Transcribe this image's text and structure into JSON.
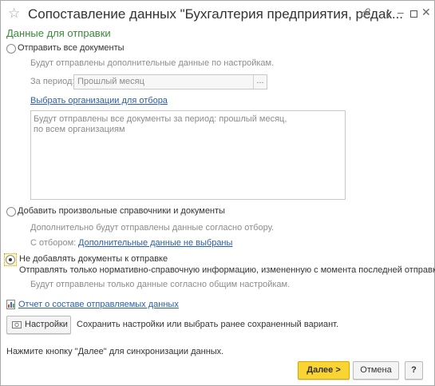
{
  "window": {
    "title": "Сопоставление данных \"Бухгалтерия предприятия, редак...",
    "icons": {
      "favorite": "star-icon",
      "link": "link-icon",
      "more": "more-icon",
      "minimize": "minimize-icon",
      "maximize": "maximize-icon",
      "close": "close-icon"
    }
  },
  "section_title": "Данные для отправки",
  "option_all": {
    "label": "Отправить все документы",
    "hint": "Будут отправлены дополнительные данные по настройкам.",
    "period_label": "За период:",
    "period_value": "Прошлый месяц",
    "period_button": "...",
    "select_org_link": "Выбрать организации для отбора",
    "summary_line1": "Будут отправлены все документы за период: прошлый месяц,",
    "summary_line2": "по всем организациям"
  },
  "option_custom": {
    "label": "Добавить произвольные справочники и документы",
    "hint": "Дополнительно будут отправлены данные согласно отбору.",
    "filter_label": "С отбором:",
    "filter_link": "Дополнительные данные не выбраны"
  },
  "option_none": {
    "label": "Не добавлять документы к отправке",
    "desc": "Отправлять только нормативно-справочную информацию, измененную с момента последней отправки.",
    "hint": "Будут отправлены только данные согласно общим настройкам.",
    "selected": true
  },
  "report_link": "Отчет о составе отправляемых данных",
  "settings": {
    "button_label": "Настройки",
    "description": "Сохранить настройки или выбрать ранее сохраненный вариант."
  },
  "footer_hint": "Нажмите кнопку \"Далее\" для синхронизации данных.",
  "buttons": {
    "next": "Далее >",
    "cancel": "Отмена",
    "help": "?"
  },
  "colors": {
    "accent_green": "#3b8a3b",
    "link": "#2b5ea6",
    "primary": "#f9d433"
  }
}
